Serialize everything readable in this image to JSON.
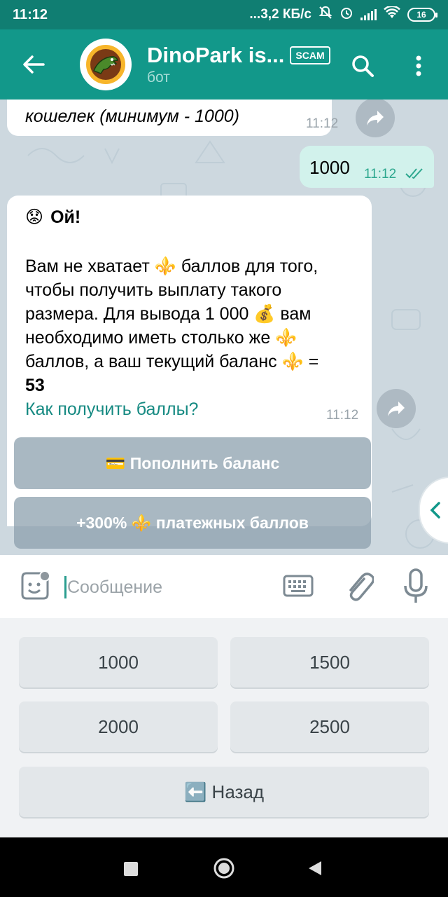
{
  "status": {
    "time": "11:12",
    "speed": "...3,2 КБ/с",
    "battery": "16"
  },
  "header": {
    "title": "DinoPark is...",
    "badge": "SCAM",
    "subtitle": "бот"
  },
  "messages": [
    {
      "type": "incoming",
      "text": "кошелек (минимум - 1000)",
      "time": "11:12"
    },
    {
      "type": "outgoing",
      "text": "1000",
      "time": "11:12"
    },
    {
      "type": "incoming",
      "heading": "Ой!",
      "heading_emoji": "😟",
      "body_lines": [
        "Вам не хватает ⚜️ баллов для того,",
        "чтобы получить выплату такого",
        "размера. Для вывода 1 000 💰 вам",
        "необходимо иметь столько же ⚜️",
        "баллов, а ваш текущий баланс ⚜️ ="
      ],
      "balance": "53",
      "link": "Как получить баллы?",
      "time": "11:12"
    }
  ],
  "inline_keyboard": [
    {
      "label": "💳 Пополнить баланс"
    },
    {
      "label": "+300% ⚜️ платежных баллов"
    }
  ],
  "input": {
    "placeholder": "Сообщение"
  },
  "reply_keyboard": [
    {
      "label": "1000"
    },
    {
      "label": "1500"
    },
    {
      "label": "2000"
    },
    {
      "label": "2500"
    },
    {
      "label": "⬅️ Назад"
    }
  ],
  "colors": {
    "header": "#12988a",
    "status_bar": "#107e72",
    "outgoing_bubble": "#d2f2ec",
    "link": "#168a82",
    "chat_background": "#cdd8df"
  }
}
